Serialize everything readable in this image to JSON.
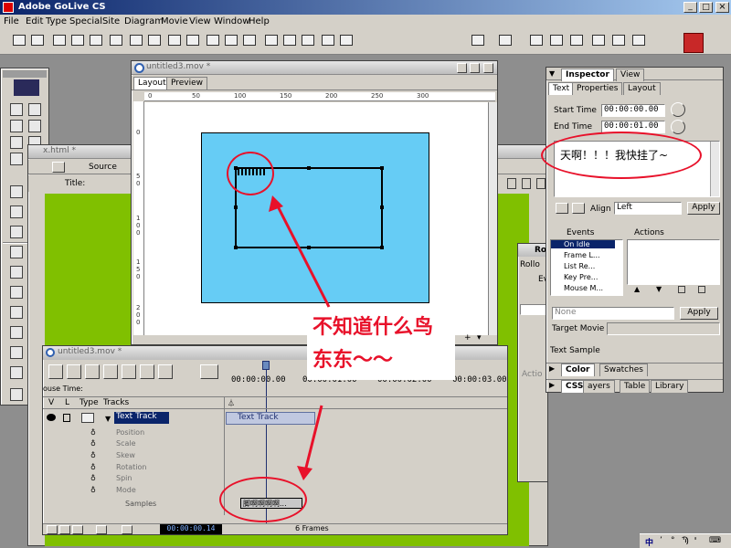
{
  "app": {
    "title": "Adobe GoLive CS"
  },
  "menu": [
    "File",
    "Edit",
    "Type",
    "Special",
    "Site",
    "Diagram",
    "Movie",
    "View",
    "Window",
    "Help"
  ],
  "window_buttons": {
    "minimize": "_",
    "maximize": "□",
    "close": "×"
  },
  "movie_window": {
    "title": "untitled3.mov *",
    "tabs": [
      "Layout",
      "Preview"
    ],
    "ruler_marks": [
      "0",
      "50",
      "100",
      "150",
      "200",
      "250",
      "300"
    ],
    "vruler_marks": [
      "0",
      "5 0",
      "1 0 0",
      "1 5 0",
      "2 0 0"
    ]
  },
  "html_window": {
    "title": "x.html *",
    "tabs": [
      "Source"
    ],
    "title_label": "Title:"
  },
  "timeline": {
    "title": "untitled3.mov *",
    "mouse_time_label": "ouse Time:",
    "columns": {
      "v": "V",
      "l": "L",
      "type": "Type",
      "tracks": "Tracks"
    },
    "times": [
      "00:00:00.00",
      "00:00:01.00",
      "00:00:02.00",
      "00:00:03.00"
    ],
    "track_name": "Text Track",
    "track_bar_label": "Text Track",
    "sub_tracks": [
      "Position",
      "Scale",
      "Skew",
      "Rotation",
      "Spin",
      "Mode"
    ],
    "samples_label": "Samples",
    "sample_bar_text": "脚啊啊啊啊...",
    "current_time": "00:00:00.14",
    "frames": "6 Frames"
  },
  "inspector": {
    "tabs": [
      "Inspector",
      "View"
    ],
    "subtabs": [
      "Text",
      "Properties",
      "Layout"
    ],
    "start_time_label": "Start Time",
    "start_time": "00:00:00.00",
    "end_time_label": "End Time",
    "end_time": "00:00:01.00",
    "text_content": "天啊！！！我快挂了~",
    "align_label": "Align",
    "align_value": "Left",
    "apply_label": "Apply",
    "events_header": "Events",
    "actions_header": "Actions",
    "events": [
      "On Idle",
      "Frame L...",
      "List Re...",
      "Key Pre...",
      "Mouse M..."
    ],
    "none_value": "None",
    "target_movie_label": "Target Movie",
    "text_sample_label": "Text Sample",
    "color_tabs": [
      "Color",
      "Swatches"
    ],
    "css_tabs": [
      "CSS",
      "ayers",
      "Table",
      "Library"
    ]
  },
  "rollover_panel": {
    "title_fragment": "Ro",
    "label_fragment": "Rollo",
    "col_fragment": "Ev",
    "button_fragment": "Actio"
  },
  "annotation": {
    "line1": "不知道什么鸟",
    "line2": "东东～～"
  },
  "colors": {
    "movie_bg": "#66ccf5",
    "green_pane": "#80c000",
    "annotation_red": "#e8112a",
    "track_selected": "#0a246a"
  },
  "taskbar": {
    "ime": "中",
    "items": [
      "ʼ",
      "°",
      "Ϡ",
      "ᶧ",
      "⌨"
    ]
  }
}
